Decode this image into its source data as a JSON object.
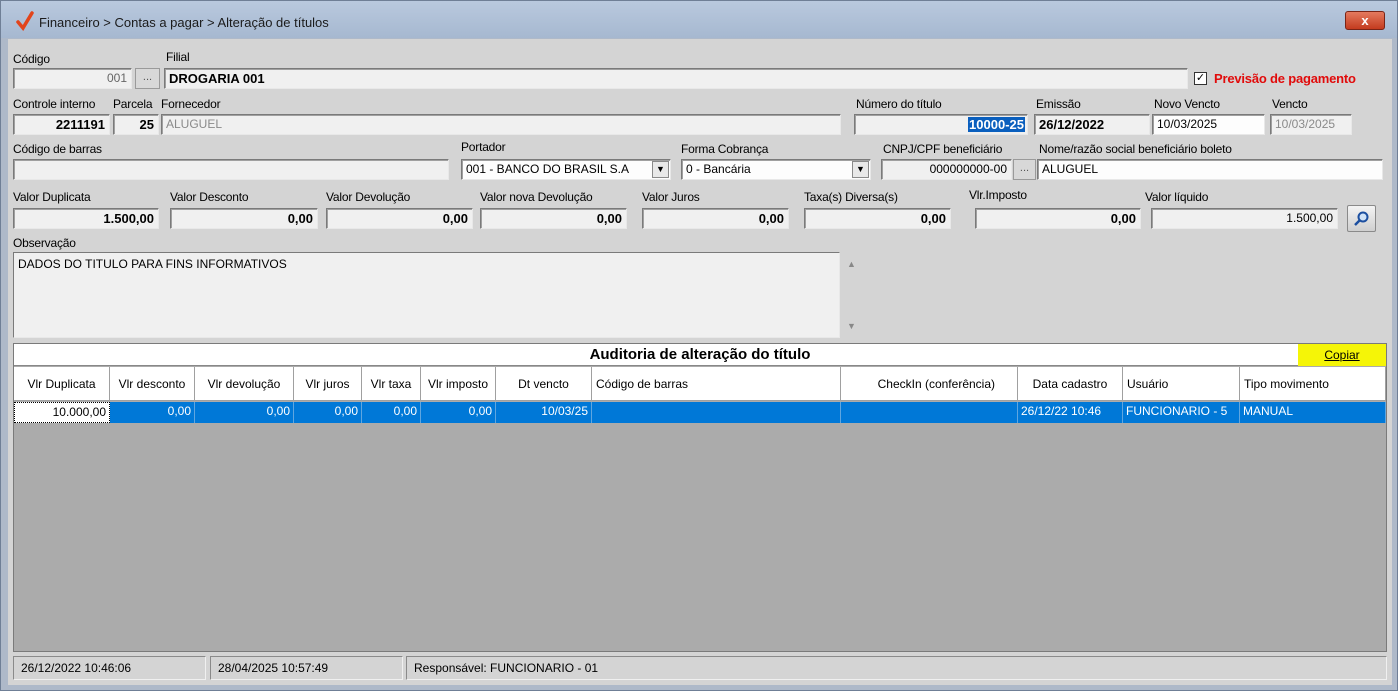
{
  "window": {
    "title": "Financeiro > Contas a pagar > Alteração de títulos",
    "close_label": "x"
  },
  "header": {
    "codigo_label": "Código",
    "codigo_value": "001",
    "filial_label": "Filial",
    "filial_value": "DROGARIA 001",
    "previsao_label": "Previsão de pagamento",
    "previsao_checked": true
  },
  "row2": {
    "controle_label": "Controle interno",
    "controle_value": "2211191",
    "parcela_label": "Parcela",
    "parcela_value": "25",
    "fornecedor_label": "Fornecedor",
    "fornecedor_value": "ALUGUEL",
    "numero_label": "Número do título",
    "numero_value": "10000-25",
    "emissao_label": "Emissão",
    "emissao_value": "26/12/2022",
    "novo_vencto_label": "Novo Vencto",
    "novo_vencto_value": "10/03/2025",
    "vencto_label": "Vencto",
    "vencto_value": "10/03/2025"
  },
  "row3": {
    "codigo_barras_label": "Código de barras",
    "codigo_barras_value": "",
    "portador_label": "Portador",
    "portador_value": "001 - BANCO DO BRASIL S.A",
    "forma_label": "Forma Cobrança",
    "forma_value": "0 - Bancária",
    "cnpj_label": "CNPJ/CPF beneficiário",
    "cnpj_value": "000000000-00",
    "nome_label": "Nome/razão social beneficiário boleto",
    "nome_value": "ALUGUEL"
  },
  "values": {
    "duplicata_label": "Valor Duplicata",
    "duplicata_value": "1.500,00",
    "desconto_label": "Valor Desconto",
    "desconto_value": "0,00",
    "devolucao_label": "Valor Devolução",
    "devolucao_value": "0,00",
    "nova_devolucao_label": "Valor nova Devolução",
    "nova_devolucao_value": "0,00",
    "juros_label": "Valor Juros",
    "juros_value": "0,00",
    "taxas_label": "Taxa(s) Diversa(s)",
    "taxas_value": "0,00",
    "imposto_label": "Vlr.Imposto",
    "imposto_value": "0,00",
    "liquido_label": "Valor líquido",
    "liquido_value": "1.500,00"
  },
  "observacao": {
    "label": "Observação",
    "value": "DADOS DO TITULO PARA FINS INFORMATIVOS"
  },
  "auditoria": {
    "title": "Auditoria de alteração do título",
    "copy_label": "Copiar",
    "columns": [
      "Vlr Duplicata",
      "Vlr desconto",
      "Vlr devolução",
      "Vlr juros",
      "Vlr taxa",
      "Vlr imposto",
      "Dt vencto",
      "Código de barras",
      "CheckIn (conferência)",
      "Data cadastro",
      "Usuário",
      "Tipo  movimento"
    ],
    "rows": [
      [
        "10.000,00",
        "0,00",
        "0,00",
        "0,00",
        "0,00",
        "0,00",
        "10/03/25",
        "",
        "",
        "26/12/22 10:46",
        "FUNCIONARIO - 5",
        "MANUAL"
      ]
    ]
  },
  "status": {
    "created": "26/12/2022 10:46:06",
    "updated": "28/04/2025 10:57:49",
    "responsavel": "Responsável: FUNCIONARIO - 01"
  }
}
